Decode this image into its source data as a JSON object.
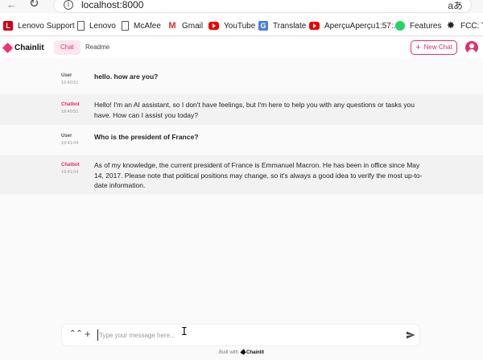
{
  "browser": {
    "url": "localhost:8000",
    "translate_icon": "aあ",
    "bookmarks": [
      {
        "label": "Lenovo Support",
        "icon": "lenovo-icon"
      },
      {
        "label": "Lenovo",
        "icon": "page-icon"
      },
      {
        "label": "McAfee",
        "icon": "page-icon"
      },
      {
        "label": "Gmail",
        "icon": "gmail-icon"
      },
      {
        "label": "YouTube",
        "icon": "youtube-icon"
      },
      {
        "label": "Translate",
        "icon": "translate-icon"
      },
      {
        "label": "AperçuAperçu1:57:...",
        "icon": "youtube-icon"
      },
      {
        "label": "Features",
        "icon": "whatsapp-icon"
      },
      {
        "label": "FCC: Tec",
        "icon": "fcc-icon"
      }
    ]
  },
  "header": {
    "logo_text": "Chainlit",
    "tabs": [
      {
        "label": "Chat",
        "active": true
      },
      {
        "label": "Readme",
        "active": false
      }
    ],
    "new_chat_label": "New Chat"
  },
  "messages": [
    {
      "author": "User",
      "time": "19:40:51",
      "text": "hello. how are you?"
    },
    {
      "author": "Chatbot",
      "time": "19:40:51",
      "text": "Hello! I'm an AI assistant, so I don't have feelings, but I'm here to help you with any questions or tasks you have. How can I assist you today?"
    },
    {
      "author": "User",
      "time": "19:41:04",
      "text": "Who is the president of France?"
    },
    {
      "author": "Chatbot",
      "time": "19:41:04",
      "text": "As of my knowledge, the current president of France is Emmanuel Macron. He has been in office since May 14, 2017. Please note that political positions may change, so it's always a good idea to verify the most up-to-date information."
    }
  ],
  "composer": {
    "placeholder": "Type your message here...",
    "value": ""
  },
  "footer": {
    "built_with": "Built with",
    "brand": "Chainlit"
  },
  "colors": {
    "accent": "#e0306a",
    "bot_row_bg": "#f2f2f3",
    "page_bg": "#fafafb"
  }
}
